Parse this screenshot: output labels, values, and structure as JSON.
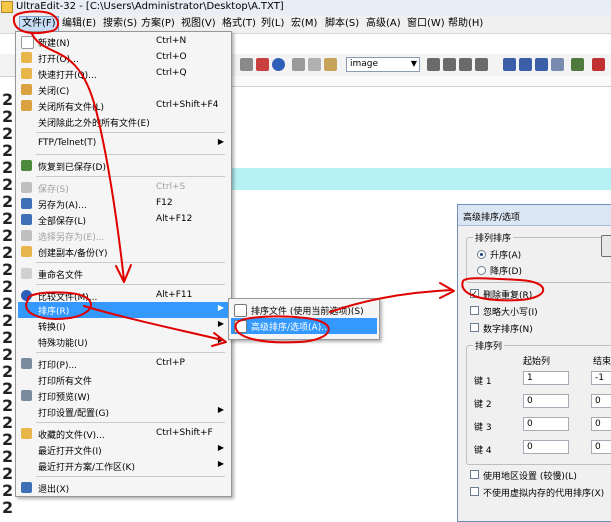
{
  "window": {
    "title": "UltraEdit-32 - [C:\\Users\\Administrator\\Desktop\\A.TXT]"
  },
  "menubar": [
    {
      "label": "文件(F)",
      "active": true
    },
    {
      "label": "编辑(E)"
    },
    {
      "label": "搜索(S)"
    },
    {
      "label": "方案(P)"
    },
    {
      "label": "视图(V)"
    },
    {
      "label": "格式(T)"
    },
    {
      "label": "列(L)"
    },
    {
      "label": "宏(M)"
    },
    {
      "label": "脚本(S)"
    },
    {
      "label": "高级(A)"
    },
    {
      "label": "窗口(W)"
    },
    {
      "label": "帮助(H)"
    }
  ],
  "toolbar": {
    "combo_value": "image"
  },
  "editor": {
    "line_numbers": [
      "2",
      "2",
      "2",
      "2",
      "2",
      "2",
      "2",
      "2",
      "2",
      "2",
      "2",
      "2",
      "2",
      "2",
      "2",
      "2",
      "2",
      "2",
      "2",
      "2",
      "2",
      "2",
      "2",
      "2",
      "2"
    ]
  },
  "file_menu": {
    "items": [
      {
        "label": "新建(N)",
        "shortcut": "Ctrl+N"
      },
      {
        "label": "打开(O)...",
        "shortcut": "Ctrl+O"
      },
      {
        "label": "快速打开(Q)...",
        "shortcut": "Ctrl+Q"
      },
      {
        "label": "关闭(C)",
        "shortcut": ""
      },
      {
        "label": "关闭所有文件(L)",
        "shortcut": "Ctrl+Shift+F4"
      },
      {
        "label": "关闭除此之外的所有文件(E)",
        "shortcut": ""
      },
      {
        "label": "FTP/Telnet(T)",
        "shortcut": ""
      },
      {
        "label": "恢复到已保存(D)",
        "shortcut": ""
      },
      {
        "label": "保存(S)",
        "shortcut": "Ctrl+S"
      },
      {
        "label": "另存为(A)...",
        "shortcut": "F12"
      },
      {
        "label": "全部保存(L)",
        "shortcut": "Alt+F12"
      },
      {
        "label": "选择另存为(E)...",
        "shortcut": ""
      },
      {
        "label": "创建副本/备份(Y)",
        "shortcut": ""
      },
      {
        "label": "重命名文件",
        "shortcut": ""
      },
      {
        "label": "比较文件(M)...",
        "shortcut": "Alt+F11"
      },
      {
        "label": "排序(R)",
        "shortcut": ""
      },
      {
        "label": "转换(I)",
        "shortcut": ""
      },
      {
        "label": "特殊功能(U)",
        "shortcut": ""
      },
      {
        "label": "打印(P)...",
        "shortcut": "Ctrl+P"
      },
      {
        "label": "打印所有文件",
        "shortcut": ""
      },
      {
        "label": "打印预览(W)",
        "shortcut": ""
      },
      {
        "label": "打印设置/配置(G)",
        "shortcut": ""
      },
      {
        "label": "收藏的文件(V)...",
        "shortcut": "Ctrl+Shift+F"
      },
      {
        "label": "最近打开文件(I)",
        "shortcut": ""
      },
      {
        "label": "最近打开方案/工作区(K)",
        "shortcut": ""
      },
      {
        "label": "退出(X)",
        "shortcut": ""
      }
    ]
  },
  "sort_submenu": {
    "items": [
      {
        "label": "排序文件 (使用当前选项)(S)"
      },
      {
        "label": "高级排序/选项(A)..."
      }
    ]
  },
  "sort_dialog": {
    "title": "高级排序/选项",
    "order_group": "排列排序",
    "ascending": "升序(A)",
    "descending": "降序(D)",
    "remove_duplicates": "删除重复(R)",
    "ignore_case": "忽略大小写(I)",
    "numeric_sort": "数字排序(N)",
    "sort_keys_group": "排序列",
    "start_col_header": "起始列",
    "end_col_header": "结束列",
    "keys": [
      {
        "label": "键 1",
        "start": "1",
        "end": "-1"
      },
      {
        "label": "键 2",
        "start": "0",
        "end": "0"
      },
      {
        "label": "键 3",
        "start": "0",
        "end": "0"
      },
      {
        "label": "键 4",
        "start": "0",
        "end": "0"
      }
    ],
    "use_locale": "使用地区设置 (较慢)(L)",
    "no_virtual_memory": "不使用虚拟内存的代用排序(X)"
  },
  "colors": {
    "highlight": "#3399ff",
    "annotation": "#e00000",
    "current_line": "#b6f2f4"
  }
}
